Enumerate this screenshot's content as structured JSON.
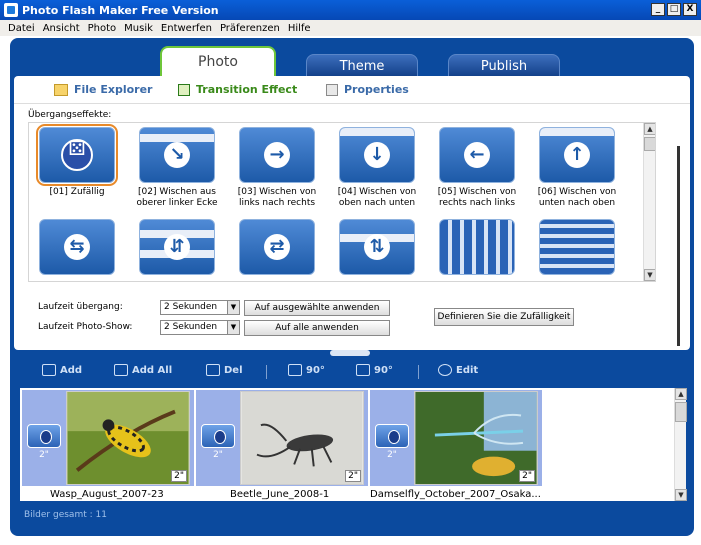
{
  "window": {
    "title": "Photo Flash Maker Free Version",
    "min": "_",
    "max": "□",
    "close": "X"
  },
  "menu": [
    "Datei",
    "Ansicht",
    "Photo",
    "Musik",
    "Entwerfen",
    "Präferenzen",
    "Hilfe"
  ],
  "tabs": [
    "Photo",
    "Theme",
    "Publish"
  ],
  "subtabs": [
    "File Explorer",
    "Transition Effect",
    "Properties"
  ],
  "effects_header": "Übergangseffekte:",
  "effects": [
    {
      "label": "[01] Zufällig",
      "icon": "dice-icon"
    },
    {
      "label": "[02] Wischen aus oberer linker Ecke",
      "icon": "arrow-down-right-icon"
    },
    {
      "label": "[03] Wischen von links nach rechts",
      "icon": "arrow-right-icon"
    },
    {
      "label": "[04] Wischen von oben nach unten",
      "icon": "arrow-down-icon"
    },
    {
      "label": "[05] Wischen von rechts nach links",
      "icon": "arrow-left-icon"
    },
    {
      "label": "[06] Wischen von unten nach oben",
      "icon": "arrow-up-icon"
    }
  ],
  "row2_icons": [
    "split-horizontal-icon",
    "split-vertical-icon",
    "split-out-icon",
    "split-center-icon",
    "blinds-vertical-icon",
    "blinds-horizontal-icon"
  ],
  "duration": {
    "transition_label": "Laufzeit übergang:",
    "transition_value": "2 Sekunden",
    "show_label": "Laufzeit Photo-Show:",
    "show_value": "2 Sekunden",
    "apply_selected": "Auf ausgewählte anwenden",
    "apply_all": "Auf alle anwenden",
    "define_random": "Definieren Sie die Zufälligkeit"
  },
  "toolbar": {
    "add": "Add",
    "add_all": "Add All",
    "del": "Del",
    "rot_ccw": "90°",
    "rot_cw": "90°",
    "edit": "Edit"
  },
  "photos": [
    {
      "name": "Wasp_August_2007-23",
      "duration": "2\"",
      "transition_duration": "2\""
    },
    {
      "name": "Beetle_June_2008-1",
      "duration": "2\"",
      "transition_duration": "2\""
    },
    {
      "name": "Damselfly_October_2007_Osaka...",
      "duration": "2\"",
      "transition_duration": "2\""
    }
  ],
  "status": "Bilder gesamt : 11",
  "colors": {
    "frame": "#0b4a9e",
    "active_tab_border": "#6ec63a",
    "selection": "#e88a2a",
    "strip_bg": "#9bb0e8"
  }
}
